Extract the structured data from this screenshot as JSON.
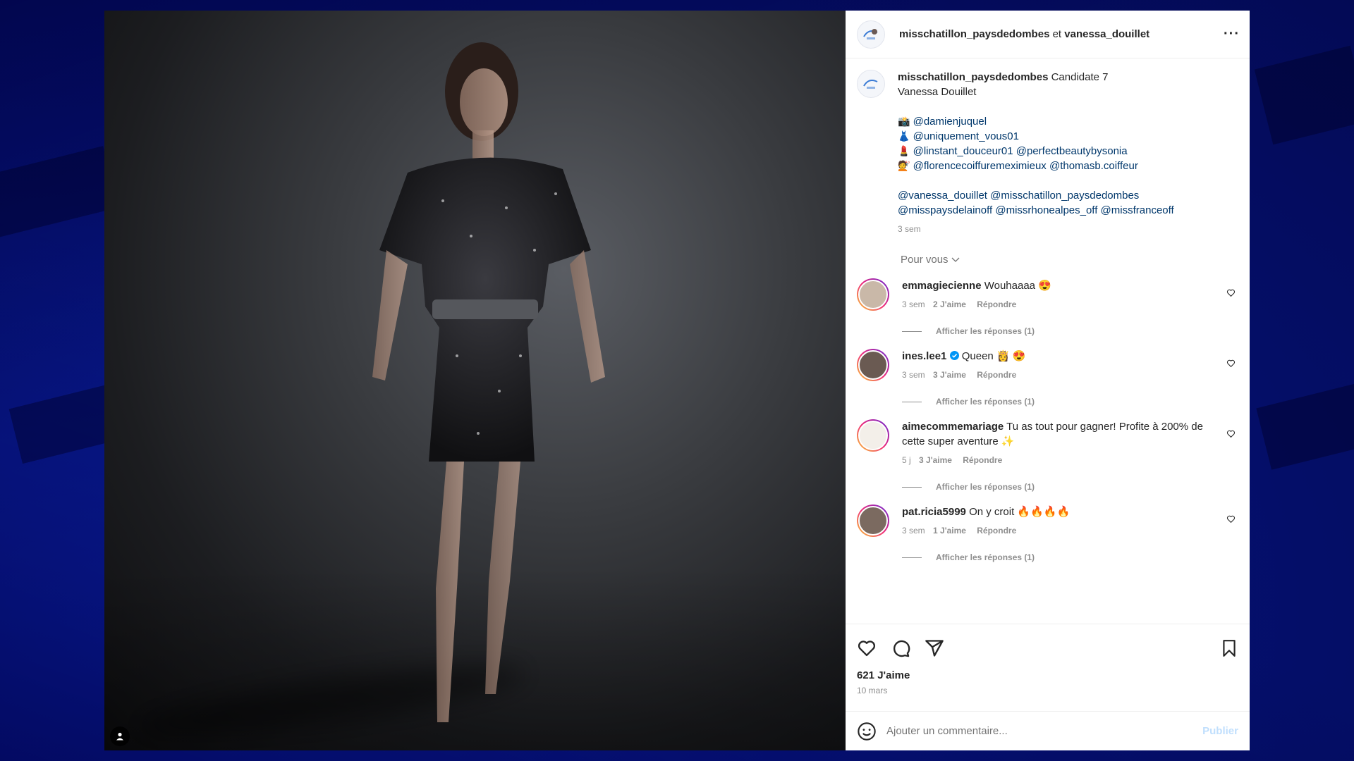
{
  "header": {
    "account1": "misschatillon_paysdedombes",
    "joiner": "et",
    "account2": "vanessa_douillet",
    "more_label": "···"
  },
  "caption": {
    "user": "misschatillon_paysdedombes",
    "line1": "Candidate 7",
    "line2": "Vanessa Douillet",
    "credits": [
      {
        "emoji": "📸",
        "mentions": "@damienjuquel"
      },
      {
        "emoji": "👗",
        "mentions": "@uniquement_vous01"
      },
      {
        "emoji": "💄",
        "mentions": "@linstant_douceur01 @perfectbeautybysonia"
      },
      {
        "emoji": "💇",
        "mentions": "@florencecoiffuremeximieux @thomasb.coiffeur"
      }
    ],
    "tags_line1": "@vanessa_douillet @misschatillon_paysdedombes",
    "tags_line2": "@misspaysdelainoff @missrhonealpes_off @missfranceoff",
    "time": "3 sem"
  },
  "filter_label": "Pour vous",
  "comments": [
    {
      "user": "emmagiecienne",
      "text": "Wouhaaaa 😍",
      "time": "3 sem",
      "likes": "2 J'aime",
      "reply": "Répondre",
      "view_replies": "Afficher les réponses (1)"
    },
    {
      "user": "ines.lee1",
      "text": "Queen 👸 😍",
      "time": "3 sem",
      "likes": "3 J'aime",
      "reply": "Répondre",
      "view_replies": "Afficher les réponses (1)"
    },
    {
      "user": "aimecommemariage",
      "text": "Tu as tout pour gagner! Profite à 200% de cette super aventure ✨",
      "time": "5 j",
      "likes": "3 J'aime",
      "reply": "Répondre",
      "view_replies": "Afficher les réponses (1)"
    },
    {
      "user": "pat.ricia5999",
      "text": "On y croit 🔥🔥🔥🔥",
      "time": "3 sem",
      "likes": "1 J'aime",
      "reply": "Répondre",
      "view_replies": "Afficher les réponses (1)"
    }
  ],
  "actions": {
    "likes": "621 J'aime",
    "date": "10 mars"
  },
  "comment_box": {
    "placeholder": "Ajouter un commentaire...",
    "publish": "Publier"
  },
  "colors": {
    "background": "#06148a",
    "mention": "#00376b",
    "muted": "#8e8e8e",
    "publish_disabled": "#c0dffd"
  },
  "icons": [
    "user-tag-icon",
    "more-icon",
    "heart-icon",
    "comment-icon",
    "share-icon",
    "bookmark-icon",
    "emoji-icon",
    "verified-icon"
  ]
}
